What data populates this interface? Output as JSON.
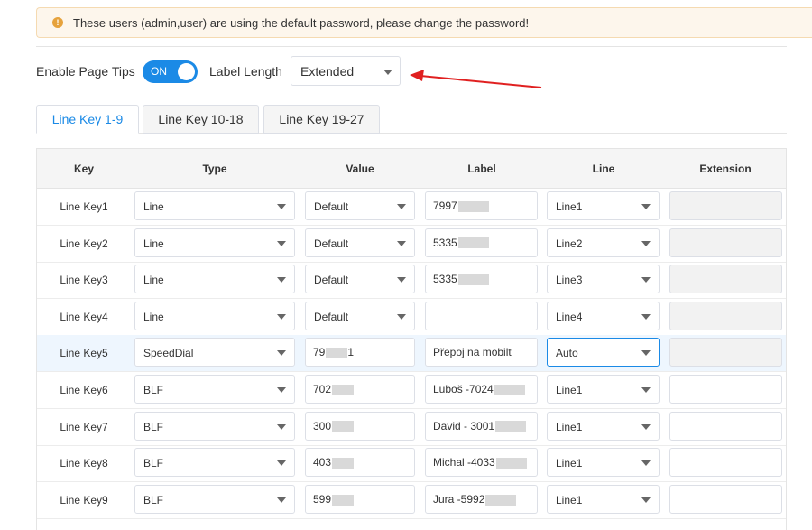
{
  "notice": {
    "text": "These users (admin,user) are using the default password, please change the password!"
  },
  "options": {
    "page_tips_label": "Enable Page Tips",
    "toggle_text": "ON",
    "label_length_label": "Label Length",
    "label_length_value": "Extended"
  },
  "tabs": [
    "Line Key 1-9",
    "Line Key 10-18",
    "Line Key 19-27"
  ],
  "active_tab": 0,
  "columns": [
    "Key",
    "Type",
    "Value",
    "Label",
    "Line",
    "Extension"
  ],
  "rows": [
    {
      "key": "Line Key1",
      "type": "Line",
      "value_mode": "select",
      "value": "Default",
      "label": "7997",
      "label_redacted": true,
      "line": "Line1",
      "extension_disabled": true
    },
    {
      "key": "Line Key2",
      "type": "Line",
      "value_mode": "select",
      "value": "Default",
      "label": "5335",
      "label_redacted": true,
      "line": "Line2",
      "extension_disabled": true
    },
    {
      "key": "Line Key3",
      "type": "Line",
      "value_mode": "select",
      "value": "Default",
      "label": "5335",
      "label_redacted": true,
      "line": "Line3",
      "extension_disabled": true
    },
    {
      "key": "Line Key4",
      "type": "Line",
      "value_mode": "select",
      "value": "Default",
      "label": "",
      "label_redacted": false,
      "line": "Line4",
      "extension_disabled": true
    },
    {
      "key": "Line Key5",
      "type": "SpeedDial",
      "value_mode": "input",
      "value": "79",
      "value_redacted": true,
      "value_suffix": "1",
      "label": "Přepoj na mobilt",
      "label_redacted": false,
      "line": "Auto",
      "extension_disabled": true
    },
    {
      "key": "Line Key6",
      "type": "BLF",
      "value_mode": "input",
      "value": "702",
      "value_redacted": true,
      "label": "Luboš -7024",
      "label_redacted": true,
      "line": "Line1",
      "extension_disabled": false
    },
    {
      "key": "Line Key7",
      "type": "BLF",
      "value_mode": "input",
      "value": "300",
      "value_redacted": true,
      "label": "David - 3001",
      "label_redacted": true,
      "line": "Line1",
      "extension_disabled": false
    },
    {
      "key": "Line Key8",
      "type": "BLF",
      "value_mode": "input",
      "value": "403",
      "value_redacted": true,
      "label": "Michal -4033",
      "label_redacted": true,
      "line": "Line1",
      "extension_disabled": false
    },
    {
      "key": "Line Key9",
      "type": "BLF",
      "value_mode": "input",
      "value": "599",
      "value_redacted": true,
      "label": "Jura -5992",
      "label_redacted": true,
      "line": "Line1",
      "extension_disabled": false
    }
  ],
  "colors": {
    "accent": "#1b8ae6",
    "warning": "#e6a23c",
    "annotation_arrow": "#e02020"
  },
  "highlighted_row": 4,
  "focused_line_select_row": 4
}
